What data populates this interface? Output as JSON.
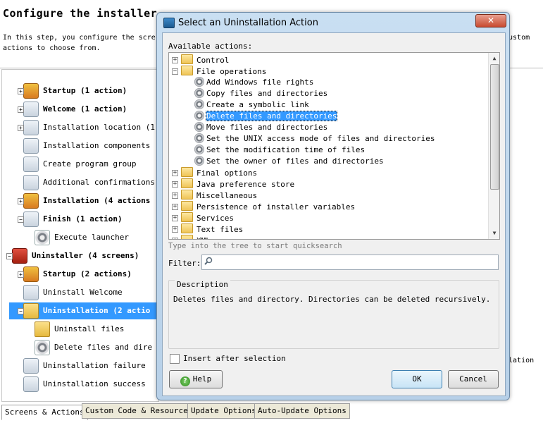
{
  "background": {
    "title": "Configure the installer",
    "description_line1": "In this step, you configure the scre",
    "description_line2": "actions to choose from.",
    "description_right": "custom",
    "tree": [
      {
        "label": "Startup (1 action)",
        "bold": true,
        "icon": "package-icon"
      },
      {
        "label": "Welcome (1 action)",
        "bold": true,
        "icon": "screen-icon"
      },
      {
        "label": "Installation location (1",
        "bold": false,
        "icon": "screen-icon"
      },
      {
        "label": "Installation components",
        "bold": false,
        "icon": "screen-icon"
      },
      {
        "label": "Create program group",
        "bold": false,
        "icon": "screen-icon"
      },
      {
        "label": "Additional confirmations",
        "bold": false,
        "icon": "screen-icon"
      },
      {
        "label": "Installation (4 actions",
        "bold": true,
        "icon": "package-icon"
      },
      {
        "label": "Finish (1 action)",
        "bold": true,
        "icon": "screen-icon"
      },
      {
        "label": "Execute launcher",
        "bold": false,
        "icon": "gear-icon"
      },
      {
        "label": "Uninstaller (4 screens)",
        "bold": true,
        "icon": "uninstaller-icon"
      },
      {
        "label": "Startup (2 actions)",
        "bold": true,
        "icon": "package-icon"
      },
      {
        "label": "Uninstall Welcome",
        "bold": false,
        "icon": "screen-icon"
      },
      {
        "label": "Uninstallation (2 actio",
        "bold": true,
        "icon": "folder-delete-icon"
      },
      {
        "label": "Uninstall files",
        "bold": false,
        "icon": "folder-delete-icon"
      },
      {
        "label": "Delete files and dire",
        "bold": false,
        "icon": "gear-icon"
      },
      {
        "label": "Uninstallation failure",
        "bold": false,
        "icon": "screen-icon"
      },
      {
        "label": "Uninstallation success",
        "bold": false,
        "icon": "screen-icon"
      }
    ],
    "right_fragment": "llation",
    "tabs": [
      "Screens & Actions",
      "Custom Code & Resources",
      "Update Options",
      "Auto-Update Options"
    ]
  },
  "dialog": {
    "title": "Select an Uninstallation Action",
    "close_label": "✕",
    "available_label": "Available actions:",
    "tree": [
      {
        "label": "Control",
        "type": "folder",
        "level": 0,
        "expander": "+"
      },
      {
        "label": "File operations",
        "type": "folder",
        "level": 0,
        "expander": "-"
      },
      {
        "label": "Add Windows file rights",
        "type": "action",
        "level": 1
      },
      {
        "label": "Copy files and directories",
        "type": "action",
        "level": 1
      },
      {
        "label": "Create a symbolic link",
        "type": "action",
        "level": 1
      },
      {
        "label": "Delete files and directories",
        "type": "action",
        "level": 1,
        "selected": true
      },
      {
        "label": "Move files and directories",
        "type": "action",
        "level": 1
      },
      {
        "label": "Set the UNIX access mode of files and directories",
        "type": "action",
        "level": 1
      },
      {
        "label": "Set the modification time of files",
        "type": "action",
        "level": 1
      },
      {
        "label": "Set the owner of files and directories",
        "type": "action",
        "level": 1
      },
      {
        "label": "Final options",
        "type": "folder",
        "level": 0,
        "expander": "+"
      },
      {
        "label": "Java preference store",
        "type": "folder",
        "level": 0,
        "expander": "+"
      },
      {
        "label": "Miscellaneous",
        "type": "folder",
        "level": 0,
        "expander": "+"
      },
      {
        "label": "Persistence of installer variables",
        "type": "folder",
        "level": 0,
        "expander": "+"
      },
      {
        "label": "Services",
        "type": "folder",
        "level": 0,
        "expander": "+"
      },
      {
        "label": "Text files",
        "type": "folder",
        "level": 0,
        "expander": "+"
      },
      {
        "label": "XML",
        "type": "folder",
        "level": 0,
        "expander": "+"
      }
    ],
    "quicksearch_hint": "Type into the tree to start quicksearch",
    "filter_label": "Filter:",
    "filter_value": "",
    "description_title": "Description",
    "description_text": "Deletes files and directory. Directories can be deleted recursively.",
    "insert_after_label": "Insert after selection",
    "insert_after_checked": false,
    "help_label": "Help",
    "ok_label": "OK",
    "cancel_label": "Cancel"
  }
}
